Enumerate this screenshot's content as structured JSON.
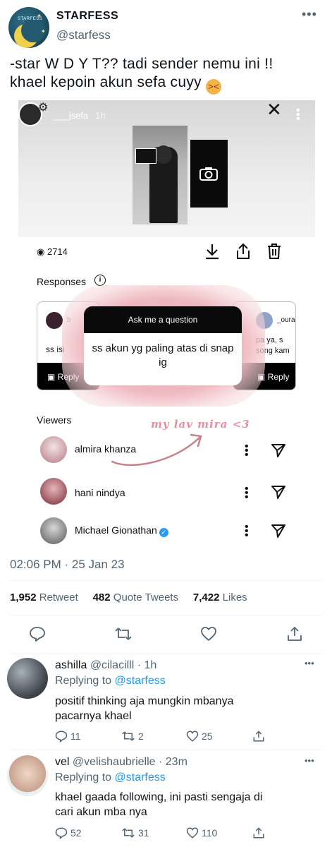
{
  "author": {
    "name": "STARFESS",
    "handle": "@starfess",
    "avatar_text": "STARFESS",
    "avatar_icon": "moon-stars-logo"
  },
  "tweet": {
    "text_line1": "-star W D Y T?? tadi sender nemu ini !!",
    "text_line2": "khael kepoin akun sefa cuyy",
    "emoji": "persevering-face-emoji",
    "timestamp": "02:06 PM · 25 Jan 23"
  },
  "story": {
    "username": "___jsefa",
    "time": "1h",
    "view_count": "2714",
    "responses_label": "Responses",
    "left_response_text": "ss isi",
    "left_response_user": "b",
    "right_response_text_1": "pa ya, s",
    "right_response_text_2": "song kam",
    "right_response_user": "_oura",
    "reply_label": "Reply",
    "ask_title": "Ask me a question",
    "ask_answer": "ss akun yg paling atas di snap ig",
    "handwritten_note": "my lav mira <3",
    "viewers_label": "Viewers",
    "viewers": [
      {
        "name": "almira khanza",
        "verified": false
      },
      {
        "name": "hani nindya",
        "verified": false
      },
      {
        "name": "Michael Gionathan",
        "verified": true
      }
    ]
  },
  "stats": {
    "retweets": "1,952",
    "retweets_label": "Retweet",
    "quotes": "482",
    "quotes_label": "Quote Tweets",
    "likes": "7,422",
    "likes_label": "Likes"
  },
  "replies": [
    {
      "name": "ashilla",
      "handle": "@cilacilll",
      "time": "1h",
      "replying_prefix": "Replying to",
      "replying_to": "@starfess",
      "text_line1": "positif thinking aja mungkin mbanya",
      "text_line2": "pacarnya khael",
      "replies": "11",
      "retweets": "2",
      "likes": "25"
    },
    {
      "name": "vel",
      "handle": "@velishaubrielle",
      "time": "23m",
      "replying_prefix": "Replying to",
      "replying_to": "@starfess",
      "text_line1": "khael gaada following, ini pasti sengaja di",
      "text_line2": "cari akun mba nya",
      "replies": "52",
      "retweets": "31",
      "likes": "110"
    }
  ],
  "colors": {
    "link": "#1d9bf0",
    "muted": "#536471",
    "pink": "#e88ea0",
    "verified": "#2f9bf0"
  }
}
